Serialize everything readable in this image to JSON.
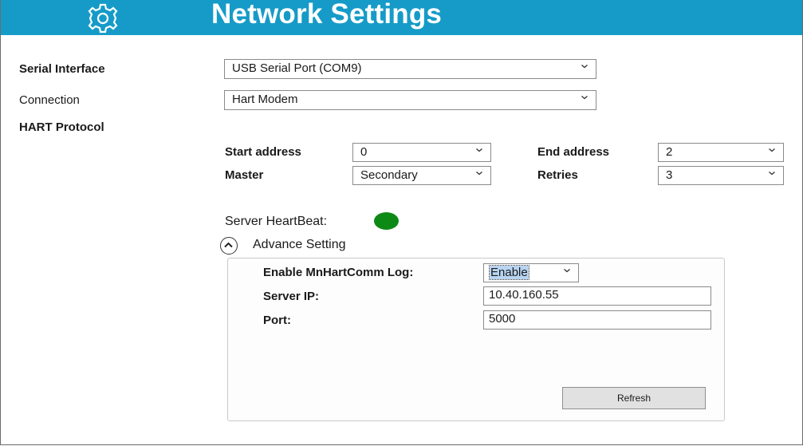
{
  "header": {
    "title": "Network Settings",
    "background": "#169bc8",
    "icon": "gear-icon"
  },
  "serial_interface": {
    "label": "Serial Interface",
    "value": "USB Serial Port (COM9)"
  },
  "connection": {
    "label": "Connection",
    "value": "Hart Modem"
  },
  "protocol": {
    "label": "HART Protocol",
    "start_address": {
      "label": "Start address",
      "value": "0"
    },
    "end_address": {
      "label": "End address",
      "value": "2"
    },
    "master": {
      "label": "Master",
      "value": "Secondary"
    },
    "retries": {
      "label": "Retries",
      "value": "3"
    }
  },
  "heartbeat": {
    "label": "Server HeartBeat:",
    "status_color": "#0d8a16"
  },
  "advance": {
    "toggle_label": "Advance Setting",
    "log": {
      "label": "Enable MnHartComm Log:",
      "value": "Enable"
    },
    "server_ip": {
      "label": "Server IP:",
      "value": "10.40.160.55"
    },
    "port": {
      "label": "Port:",
      "value": "5000"
    },
    "refresh_label": "Refresh"
  }
}
